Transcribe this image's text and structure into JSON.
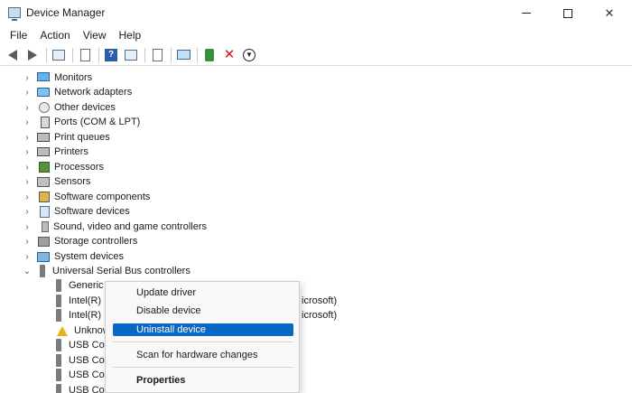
{
  "window": {
    "title": "Device Manager",
    "controls": {
      "minimize_icon": "minimize-icon",
      "maximize_icon": "maximize-icon",
      "close_glyph": "✕"
    }
  },
  "menu": [
    "File",
    "Action",
    "View",
    "Help"
  ],
  "toolbar": {
    "icons": [
      "back-icon",
      "forward-icon",
      "show-hide-tree-icon",
      "properties-icon",
      "help-icon",
      "view-icon",
      "update-driver-icon",
      "scan-hardware-icon",
      "enable-device-icon",
      "uninstall-icon",
      "disable-device-icon"
    ],
    "uninstall_glyph": "✕",
    "help_glyph": "?",
    "down_glyph": "▼"
  },
  "tree": {
    "collapsed_glyph": "›",
    "expanded_glyph": "⌄",
    "categories": [
      {
        "label": "Monitors",
        "icon": "monitor-icon"
      },
      {
        "label": "Network adapters",
        "icon": "network-adapter-icon"
      },
      {
        "label": "Other devices",
        "icon": "other-devices-icon"
      },
      {
        "label": "Ports (COM & LPT)",
        "icon": "ports-icon"
      },
      {
        "label": "Print queues",
        "icon": "print-queue-icon"
      },
      {
        "label": "Printers",
        "icon": "printer-icon"
      },
      {
        "label": "Processors",
        "icon": "processor-icon"
      },
      {
        "label": "Sensors",
        "icon": "sensor-icon"
      },
      {
        "label": "Software components",
        "icon": "software-component-icon"
      },
      {
        "label": "Software devices",
        "icon": "software-device-icon"
      },
      {
        "label": "Sound, video and game controllers",
        "icon": "sound-icon"
      },
      {
        "label": "Storage controllers",
        "icon": "storage-icon"
      },
      {
        "label": "System devices",
        "icon": "system-device-icon"
      },
      {
        "label": "Universal Serial Bus controllers",
        "icon": "usb-icon"
      }
    ],
    "usb_children": [
      {
        "label": "Generic",
        "icon": "usb-icon"
      },
      {
        "label": "Intel(R)",
        "suffix": "icrosoft)",
        "icon": "usb-icon"
      },
      {
        "label": "Intel(R)",
        "suffix": "icrosoft)",
        "icon": "usb-icon"
      },
      {
        "label": "Unknow",
        "icon": "warning-icon"
      },
      {
        "label": "USB Co",
        "icon": "usb-icon"
      },
      {
        "label": "USB Co",
        "icon": "usb-icon"
      },
      {
        "label": "USB Co",
        "icon": "usb-icon"
      },
      {
        "label": "USB Composite Device",
        "icon": "usb-icon"
      }
    ]
  },
  "context_menu": {
    "items": [
      "Update driver",
      "Disable device",
      "Uninstall device",
      "Scan for hardware changes",
      "Properties"
    ],
    "highlighted": "Uninstall device",
    "highlight_color": "#0b67c5"
  }
}
